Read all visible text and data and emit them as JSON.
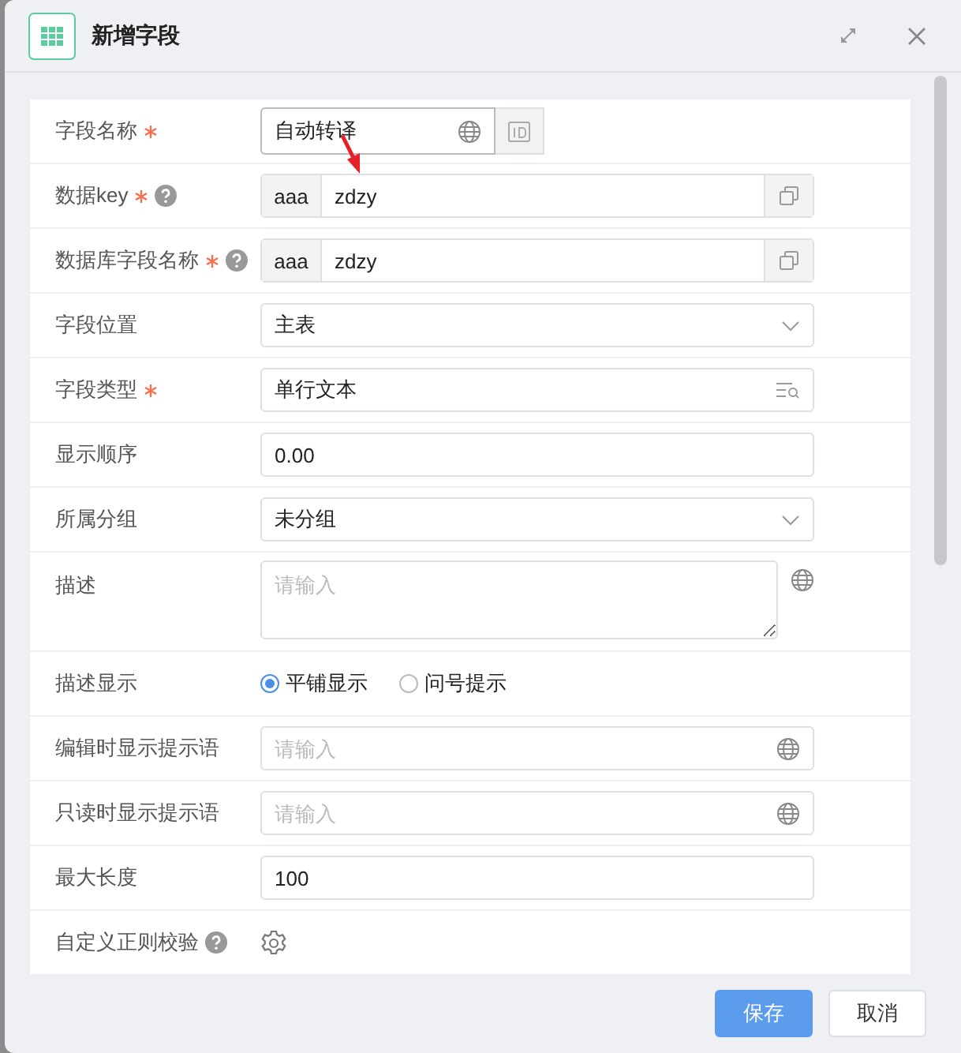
{
  "dialog": {
    "title": "新增字段"
  },
  "fields": [
    {
      "kind": "translate",
      "label": "字段名称",
      "required": true,
      "help": false,
      "value": "自动转译"
    },
    {
      "kind": "prefixed",
      "label": "数据key",
      "required": true,
      "help": true,
      "prefix": "aaa",
      "value": "zdzy"
    },
    {
      "kind": "prefixed",
      "label": "数据库字段名称",
      "required": true,
      "help": true,
      "prefix": "aaa",
      "value": "zdzy"
    },
    {
      "kind": "select",
      "label": "字段位置",
      "required": false,
      "help": false,
      "value": "主表"
    },
    {
      "kind": "lookup",
      "label": "字段类型",
      "required": true,
      "help": false,
      "value": "单行文本"
    },
    {
      "kind": "input",
      "label": "显示顺序",
      "required": false,
      "help": false,
      "value": "0.00"
    },
    {
      "kind": "select",
      "label": "所属分组",
      "required": false,
      "help": false,
      "value": "未分组"
    },
    {
      "kind": "textarea",
      "label": "描述",
      "required": false,
      "help": false,
      "placeholder": "请输入"
    },
    {
      "kind": "radio",
      "label": "描述显示",
      "required": false,
      "help": false,
      "options": [
        {
          "label": "平铺显示",
          "selected": true
        },
        {
          "label": "问号提示",
          "selected": false
        }
      ]
    },
    {
      "kind": "globe_input",
      "label": "编辑时显示提示语",
      "required": false,
      "help": false,
      "placeholder": "请输入"
    },
    {
      "kind": "globe_input",
      "label": "只读时显示提示语",
      "required": false,
      "help": false,
      "placeholder": "请输入"
    },
    {
      "kind": "input",
      "label": "最大长度",
      "required": false,
      "help": false,
      "value": "100"
    },
    {
      "kind": "gear",
      "label": "自定义正则校验",
      "required": false,
      "help": true
    }
  ],
  "buttons": [
    {
      "label": "保存",
      "primary": true
    },
    {
      "label": "取消",
      "primary": false
    }
  ]
}
